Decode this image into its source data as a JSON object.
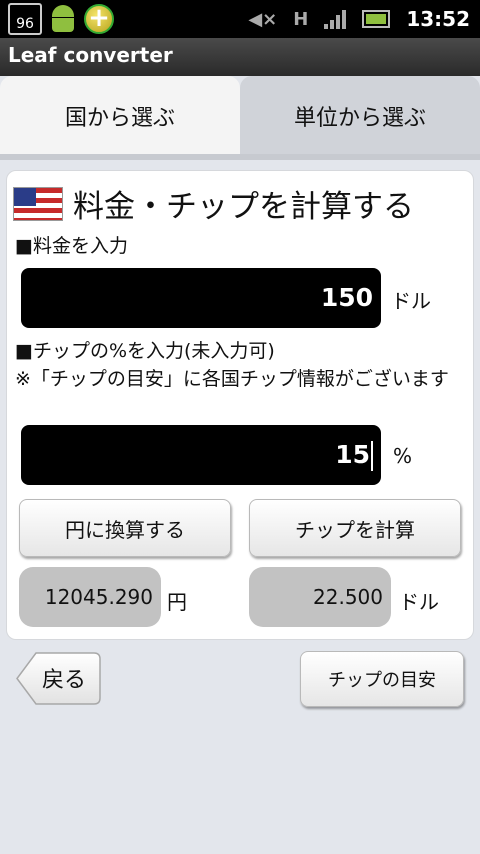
{
  "status_bar": {
    "calendar_day": "96",
    "time": "13:52",
    "network_label": "H",
    "icons": [
      "calendar-icon",
      "android-icon",
      "plus-app-icon",
      "mute-icon",
      "h-network-icon",
      "signal-icon",
      "battery-icon"
    ]
  },
  "app": {
    "title": "Leaf converter"
  },
  "tabs": [
    {
      "label": "国から選ぶ",
      "active": true
    },
    {
      "label": "単位から選ぶ",
      "active": false
    }
  ],
  "card": {
    "title": "料金・チップを計算する",
    "flag": "us-flag-icon",
    "fee_label": "■料金を入力",
    "fee_value": "150",
    "fee_unit": "ドル",
    "tip_label": "■チップの%を入力(未入力可)",
    "tip_note": "※「チップの目安」に各国チップ情報がございます",
    "tip_value": "15",
    "tip_unit": "%",
    "convert_button": "円に換算する",
    "calc_tip_button": "チップを計算",
    "yen_result": "12045.290",
    "yen_unit": "円",
    "tip_result": "22.500",
    "tip_result_unit": "ドル"
  },
  "bottom": {
    "back_button": "戻る",
    "tip_guide_button": "チップの目安"
  },
  "colors": {
    "background": "#e3e6ec",
    "field": "#000000",
    "result": "#c2c2c2",
    "title_bar": "#333333"
  }
}
